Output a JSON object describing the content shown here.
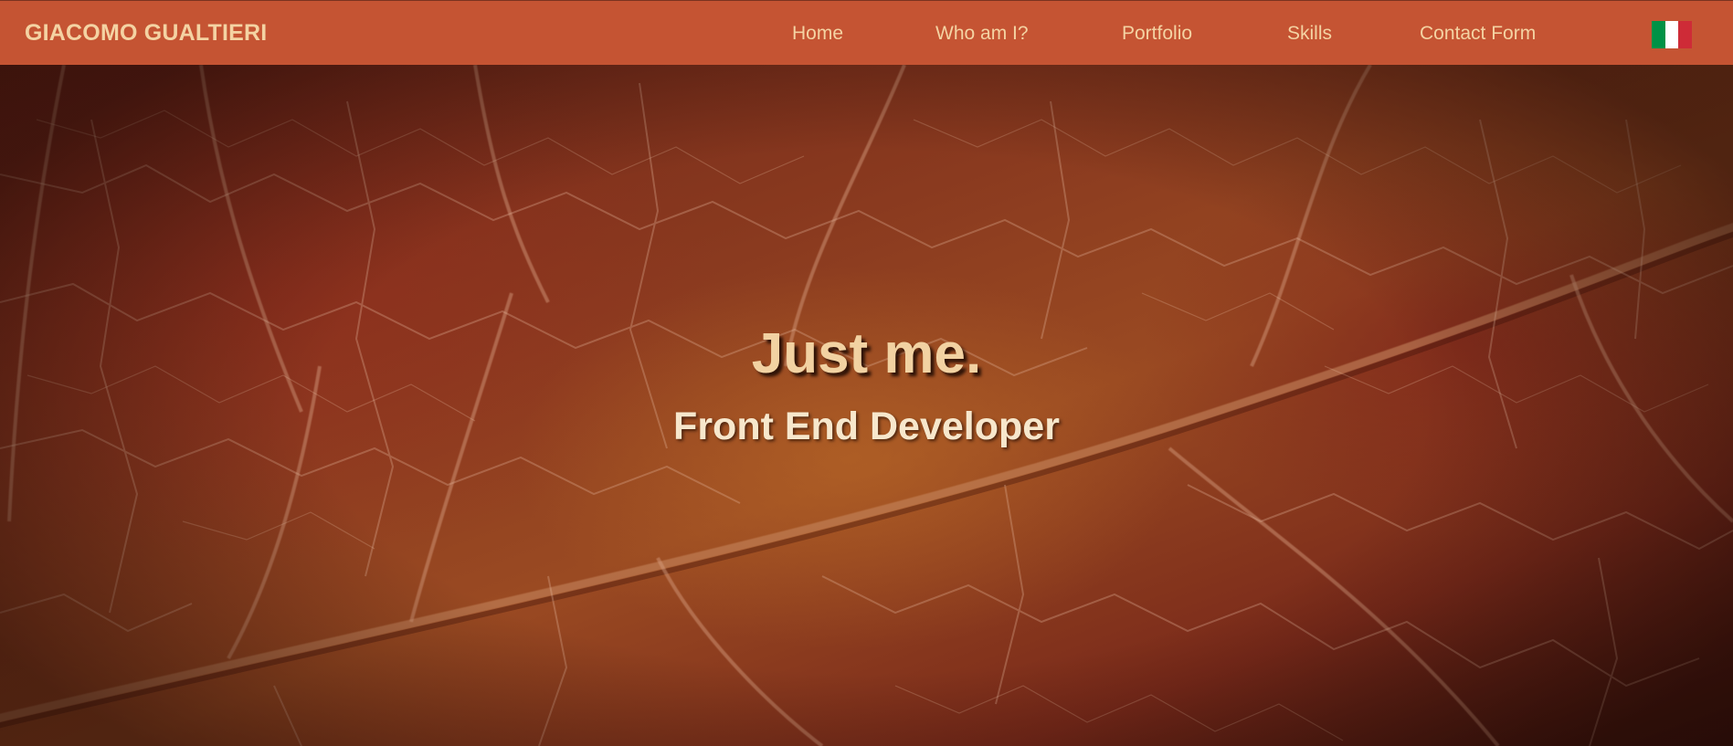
{
  "header": {
    "brand": "GIACOMO GUALTIERI",
    "nav": [
      {
        "label": "Home"
      },
      {
        "label": "Who am I?"
      },
      {
        "label": "Portfolio"
      },
      {
        "label": "Skills"
      },
      {
        "label": "Contact Form"
      }
    ],
    "language_flag": {
      "icon": "italy-flag-icon",
      "colors": [
        "#009246",
        "#ffffff",
        "#ce2b37"
      ]
    },
    "background_color": "#c55433",
    "text_color": "#f4d3a3"
  },
  "hero": {
    "heading": "Just me.",
    "subheading": "Front End Developer",
    "background": "leaf-vein-photo",
    "heading_color": "#f2d2a2",
    "subheading_color": "#f7e7cc"
  }
}
